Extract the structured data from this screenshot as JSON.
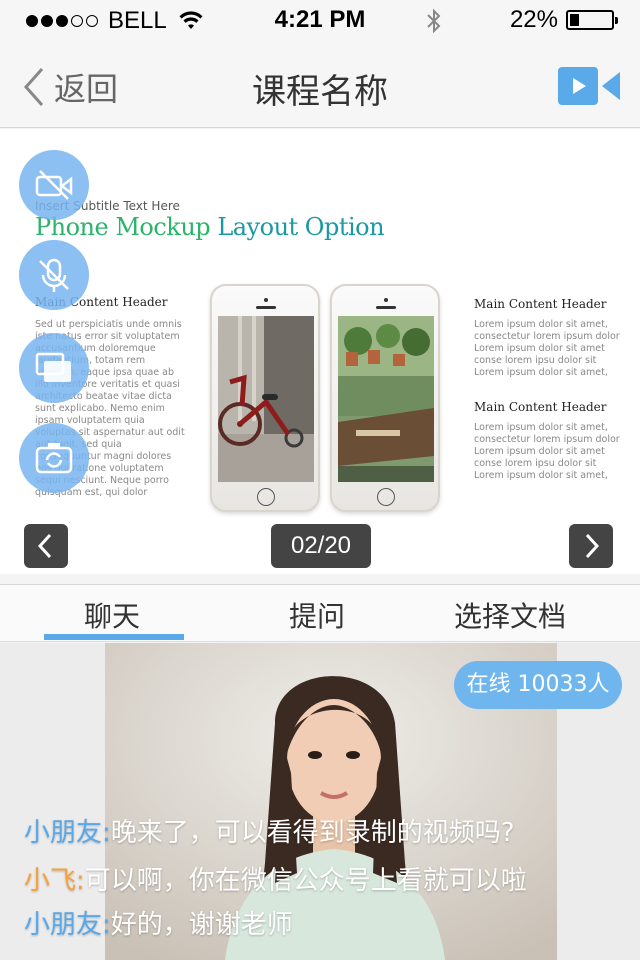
{
  "status_bar": {
    "carrier": "BELL",
    "time": "4:21 PM",
    "battery_percent": "22%",
    "battery_level": 0.22,
    "signal_bars_filled": 3,
    "signal_bars_total": 5
  },
  "nav": {
    "back_label": "返回",
    "title": "课程名称",
    "video_icon": "video-camera-icon",
    "accent_color": "#5aa9e8"
  },
  "slide": {
    "subtitle": "Insert Subtitle Text Here",
    "title_part1": "Phone Mockup ",
    "title_part2": "Layout Option",
    "left_header": "Main Content Header",
    "left_body": "Sed ut perspiciatis unde omnis iste natus error sit voluptatem accusantium doloremque laudantium, totam rem aperiam, eaque ipsa quae ab illo inventore veritatis et quasi architecto beatae vitae dicta sunt explicabo. Nemo enim ipsam voluptatem quia voluptas sit aspernatur aut odit aut fugit, sed quia consequuntur magni dolores eos qui ratione voluptatem sequi nesciunt. Neque porro quisquam est, qui dolor",
    "right_header_1": "Main Content Header",
    "right_body_1": "Lorem ipsum dolor sit amet, consectetur lorem ipsum dolor Lorem ipsum dolor sit amet conse lorem ipsu dolor sit Lorem ipsum dolor sit amet,",
    "right_header_2": "Main Content Header",
    "right_body_2": "Lorem ipsum dolor sit amet, consectetur lorem ipsum dolor Lorem ipsum dolor sit amet conse lorem ipsu dolor sit Lorem ipsum dolor sit amet,",
    "page_indicator": "02/20",
    "side_icons": [
      "camera-off-icon",
      "mic-off-icon",
      "screen-share-icon",
      "switch-camera-icon"
    ]
  },
  "tabs": {
    "chat": "聊天",
    "ask": "提问",
    "select_doc": "选择文档"
  },
  "video": {
    "online_count": "在线 10033人"
  },
  "chat": [
    {
      "name": "小朋友",
      "sep": ":",
      "message": "晚来了，可以看得到录制的视频吗?",
      "name_color": "#56a8ea"
    },
    {
      "name": "小飞",
      "sep": ":",
      "message": "可以啊，你在微信公众号上看就可以啦",
      "name_color": "#f5a23a"
    },
    {
      "name": "小朋友",
      "sep": ":",
      "message": "好的，谢谢老师",
      "name_color": "#56a8ea"
    }
  ]
}
